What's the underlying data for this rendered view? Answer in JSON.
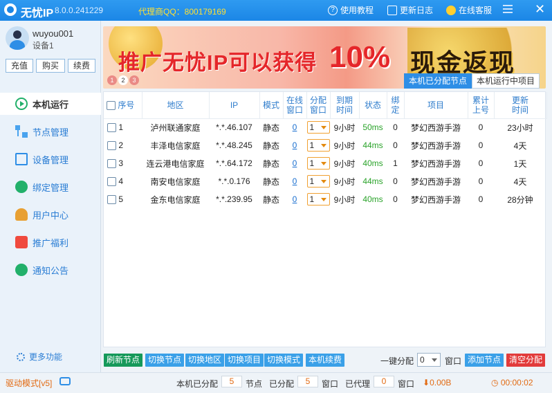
{
  "titlebar": {
    "app_name": "无忧IP",
    "version": "8.0.0.241229",
    "agent_qq": "代理商QQ：800179169",
    "tutorial": "使用教程",
    "changelog": "更新日志",
    "service": "在线客服"
  },
  "user": {
    "name": "wuyou001",
    "device": "设备1",
    "recharge": "充值",
    "buy": "购买",
    "renew": "续费"
  },
  "nav": {
    "items": [
      "本机运行",
      "节点管理",
      "设备管理",
      "绑定管理",
      "用户中心",
      "推广福利",
      "通知公告"
    ],
    "more": "更多功能"
  },
  "banner": {
    "text": "推广无忧IP可以获得",
    "percent": "10%",
    "cash": "现金返现",
    "pages": [
      "1",
      "2",
      "3"
    ]
  },
  "tabs": [
    "本机已分配节点",
    "本机运行中项目"
  ],
  "table": {
    "headers": [
      "序号",
      "地区",
      "IP",
      "模式",
      "在线\n窗口",
      "分配\n窗口",
      "到期\n时间",
      "状态",
      "绑\n定",
      "项目",
      "累计\n上号",
      "更新\n时间"
    ],
    "rows": [
      {
        "no": "1",
        "region": "泸州联通家庭",
        "ip": "*.*.46.107",
        "mode": "静态",
        "online": "0",
        "alloc": "1",
        "expire": "9小时",
        "status": "50ms",
        "bind": "0",
        "project": "梦幻西游手游",
        "total": "0",
        "updated": "23小时"
      },
      {
        "no": "2",
        "region": "丰泽电信家庭",
        "ip": "*.*.48.245",
        "mode": "静态",
        "online": "0",
        "alloc": "1",
        "expire": "9小时",
        "status": "44ms",
        "bind": "0",
        "project": "梦幻西游手游",
        "total": "0",
        "updated": "4天"
      },
      {
        "no": "3",
        "region": "连云港电信家庭",
        "ip": "*.*.64.172",
        "mode": "静态",
        "online": "0",
        "alloc": "1",
        "expire": "9小时",
        "status": "40ms",
        "bind": "1",
        "project": "梦幻西游手游",
        "total": "0",
        "updated": "1天"
      },
      {
        "no": "4",
        "region": "南安电信家庭",
        "ip": "*.*.0.176",
        "mode": "静态",
        "online": "0",
        "alloc": "1",
        "expire": "9小时",
        "status": "44ms",
        "bind": "0",
        "project": "梦幻西游手游",
        "total": "0",
        "updated": "4天"
      },
      {
        "no": "5",
        "region": "金东电信家庭",
        "ip": "*.*.239.95",
        "mode": "静态",
        "online": "0",
        "alloc": "1",
        "expire": "9小时",
        "status": "40ms",
        "bind": "0",
        "project": "梦幻西游手游",
        "total": "0",
        "updated": "28分钟"
      }
    ]
  },
  "actions": {
    "refresh": "刷新节点",
    "switch_node": "切换节点",
    "switch_region": "切换地区",
    "switch_project": "切换项目",
    "switch_mode": "切换模式",
    "renew": "本机续费",
    "onekey_label": "一键分配",
    "onekey_value": "0",
    "window_label": "窗口",
    "add_node": "添加节点",
    "clear_alloc": "清空分配"
  },
  "status": {
    "drive_mode": "驱动模式[v5]",
    "allocated_label": "本机已分配",
    "allocated_value": "5",
    "node_label": "节点",
    "assigned_label": "已分配",
    "assigned_value": "5",
    "window_label": "窗口",
    "proxied_label": "已代理",
    "proxied_value": "0",
    "window_label2": "窗口",
    "speed": "0.00B",
    "timer": "00:00:02"
  },
  "colors": {
    "title_bar": "#1b86e6",
    "accent_blue": "#2e8ee6",
    "button_blue": "#3aa0e8",
    "button_green": "#16995a",
    "button_red": "#e23b3b",
    "status_ok": "#2aa32a",
    "warning_orange": "#e26a12"
  }
}
